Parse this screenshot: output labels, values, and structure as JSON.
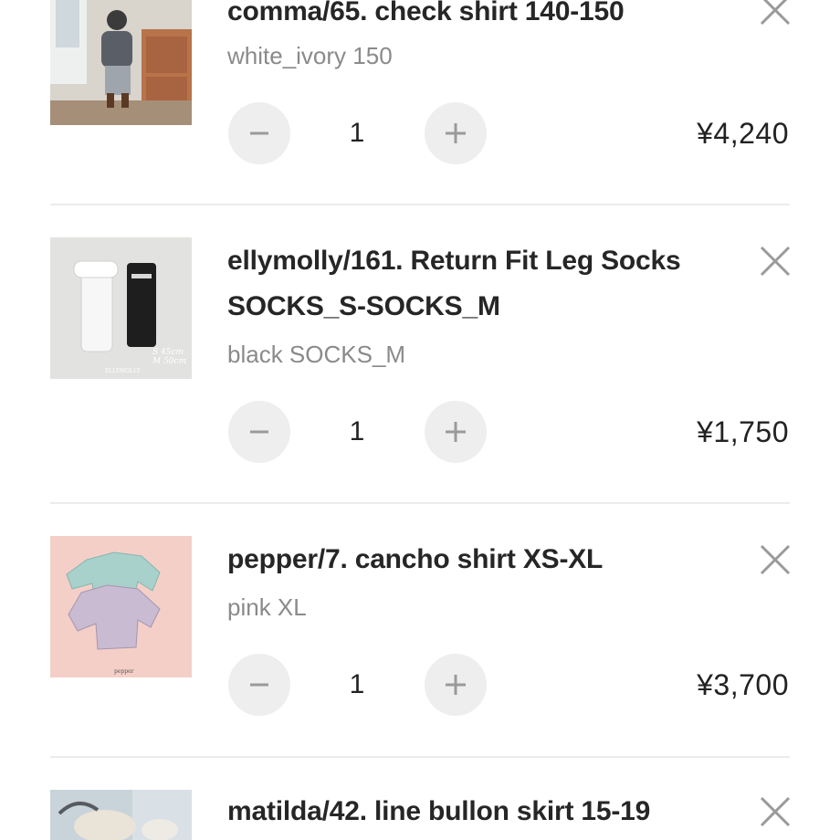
{
  "cart": {
    "items": [
      {
        "name": "comma/65. check shirt 140-150",
        "variant": "white_ivory 150",
        "quantity": "1",
        "price": "¥4,240",
        "image_desc": "girl-outfit-photo"
      },
      {
        "name": "ellymolly/161. Return Fit Leg Socks SOCKS_S-SOCKS_M",
        "variant": "black SOCKS_M",
        "quantity": "1",
        "price": "¥1,750",
        "image_desc": "leg-socks-photo",
        "image_text": [
          "S 45cm",
          "M 50cm",
          "ELLYMOLLY"
        ]
      },
      {
        "name": "pepper/7. cancho shirt XS-XL",
        "variant": "pink XL",
        "quantity": "1",
        "price": "¥3,700",
        "image_desc": "shirts-photo",
        "image_text": [
          "pepper"
        ]
      },
      {
        "name": "matilda/42. line bullon skirt 15-19",
        "image_desc": "skirt-photo"
      }
    ]
  },
  "icons": {
    "remove": "close-icon",
    "decrement": "minus-icon",
    "increment": "plus-icon"
  },
  "colors": {
    "button_bg": "#eeeeee",
    "icon_gray": "#9a9a9a",
    "variant_gray": "#8a8a8a",
    "divider": "#ececec"
  }
}
